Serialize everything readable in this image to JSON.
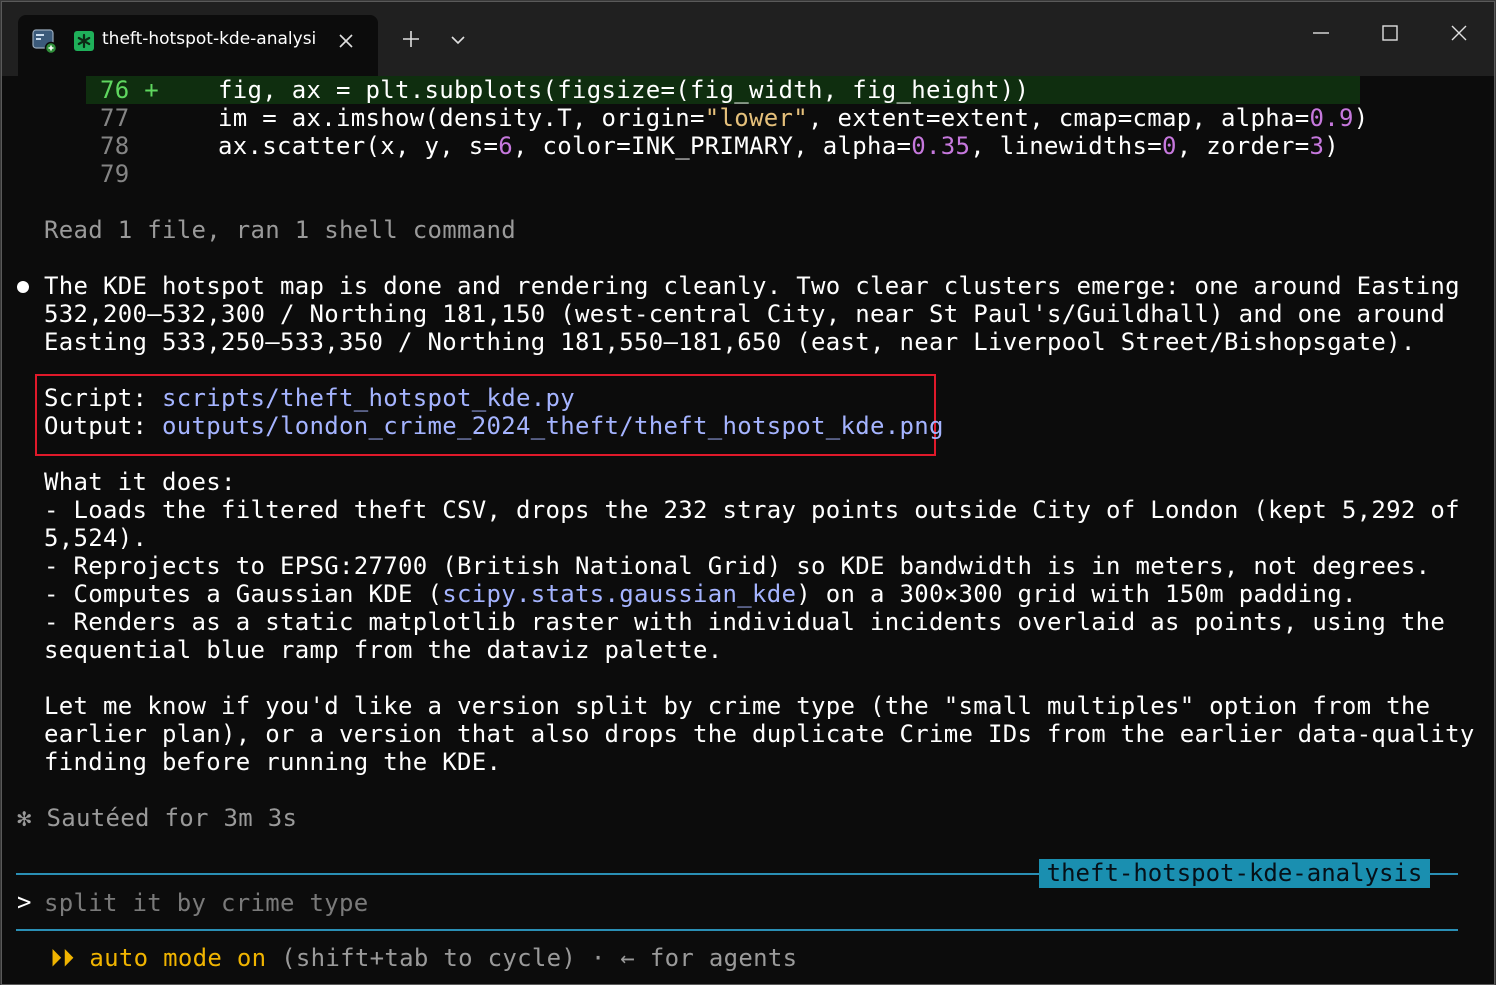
{
  "tab": {
    "title": "theft-hotspot-kde-analysi"
  },
  "diff": [
    {
      "num": "76",
      "marker": "+",
      "code": [
        [
          "    fig, ax = plt.subplots(figsize=(fig_width, fig_height))",
          "plain"
        ]
      ]
    },
    {
      "num": "77",
      "marker": " ",
      "code": [
        [
          "    im = ax.imshow(density.T, origin=",
          "plain"
        ],
        [
          "\"lower\"",
          "str"
        ],
        [
          ", extent=extent, cmap=cmap, alpha=",
          "plain"
        ],
        [
          "0.9",
          "num"
        ],
        [
          ")",
          "plain"
        ]
      ]
    },
    {
      "num": "78",
      "marker": " ",
      "code": [
        [
          "    ax.scatter(x, y, s=",
          "plain"
        ],
        [
          "6",
          "num"
        ],
        [
          ", color=INK_PRIMARY, alpha=",
          "plain"
        ],
        [
          "0.35",
          "num"
        ],
        [
          ", linewidths=",
          "plain"
        ],
        [
          "0",
          "num"
        ],
        [
          ", zorder=",
          "plain"
        ],
        [
          "3",
          "num"
        ],
        [
          ")",
          "plain"
        ]
      ]
    },
    {
      "num": "79",
      "marker": " ",
      "code": []
    }
  ],
  "summary": "Read 1 file, ran 1 shell command",
  "message": {
    "lines": [
      "The KDE hotspot map is done and rendering cleanly. Two clear clusters emerge: one around Easting",
      "532,200–532,300 / Northing 181,150 (west-central City, near St Paul's/Guildhall) and one around",
      "Easting 533,250–533,350 / Northing 181,550–181,650 (east, near Liverpool Street/Bishopsgate)."
    ],
    "script_label": "Script",
    "script_path": "scripts/theft_hotspot_kde.py",
    "output_label": "Output",
    "output_path": "outputs/london_crime_2024_theft/theft_hotspot_kde.png",
    "what_heading": "What it does:",
    "points": [
      "- Loads the filtered theft CSV, drops the 232 stray points outside City of London (kept 5,292 of",
      "5,524).",
      "- Reprojects to EPSG:27700 (British National Grid) so KDE bandwidth is in meters, not degrees.",
      {
        "before": "- Computes a Gaussian KDE (",
        "code": "scipy.stats.gaussian_kde",
        "after": ") on a 300×300 grid with 150m padding."
      },
      "- Renders as a static matplotlib raster with individual incidents overlaid as points, using the",
      "sequential blue ramp from the dataviz palette."
    ],
    "closing": [
      "Let me know if you'd like a version split by crime type (the \"small multiples\" option from the",
      "earlier plan), or a version that also drops the duplicate Crime IDs from the earlier data-quality",
      "finding before running the KDE."
    ]
  },
  "status": {
    "glyph": "✻",
    "text": "Sautéed for 3m 3s"
  },
  "session_label": "theft-hotspot-kde-analysis",
  "prompt": {
    "symbol": ">",
    "placeholder": "split it by crime type"
  },
  "footer": {
    "arrows": "⏵⏵",
    "mode": "auto mode on",
    "hint": "(shift+tab to cycle)",
    "separator": "·",
    "agents": "← for agents"
  },
  "colors": {
    "accent": "#1a8fb0",
    "highlight": "#e0192a",
    "add": "#5fd75f"
  }
}
